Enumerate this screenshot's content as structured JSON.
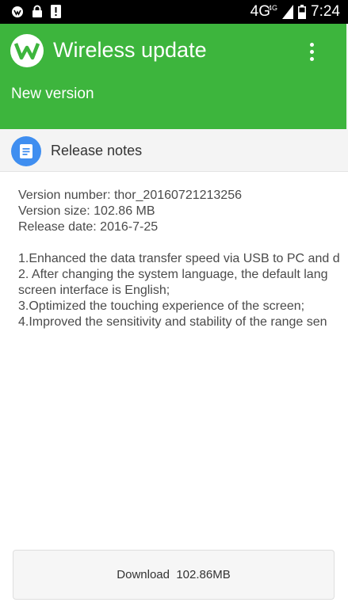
{
  "status_bar": {
    "network": "4G",
    "network_small": "4G",
    "time": "7:24"
  },
  "app_bar": {
    "title": "Wireless update",
    "subtitle": "New version"
  },
  "release_notes": {
    "title": "Release notes",
    "version_number": "Version number: thor_20160721213256",
    "version_size": "Version size: 102.86 MB",
    "release_date": "Release date: 2016-7-25",
    "changes": [
      "1.Enhanced the data transfer speed via USB to PC and d",
      "2. After changing the system language, the default lang",
      "screen interface is English;",
      "3.Optimized the touching experience of the screen;",
      "4.Improved the sensitivity and stability of the range sen"
    ]
  },
  "download": {
    "label": "Download  102.86MB"
  },
  "colors": {
    "accent_green": "#3db53d",
    "notes_icon_blue": "#3f8ef0"
  }
}
